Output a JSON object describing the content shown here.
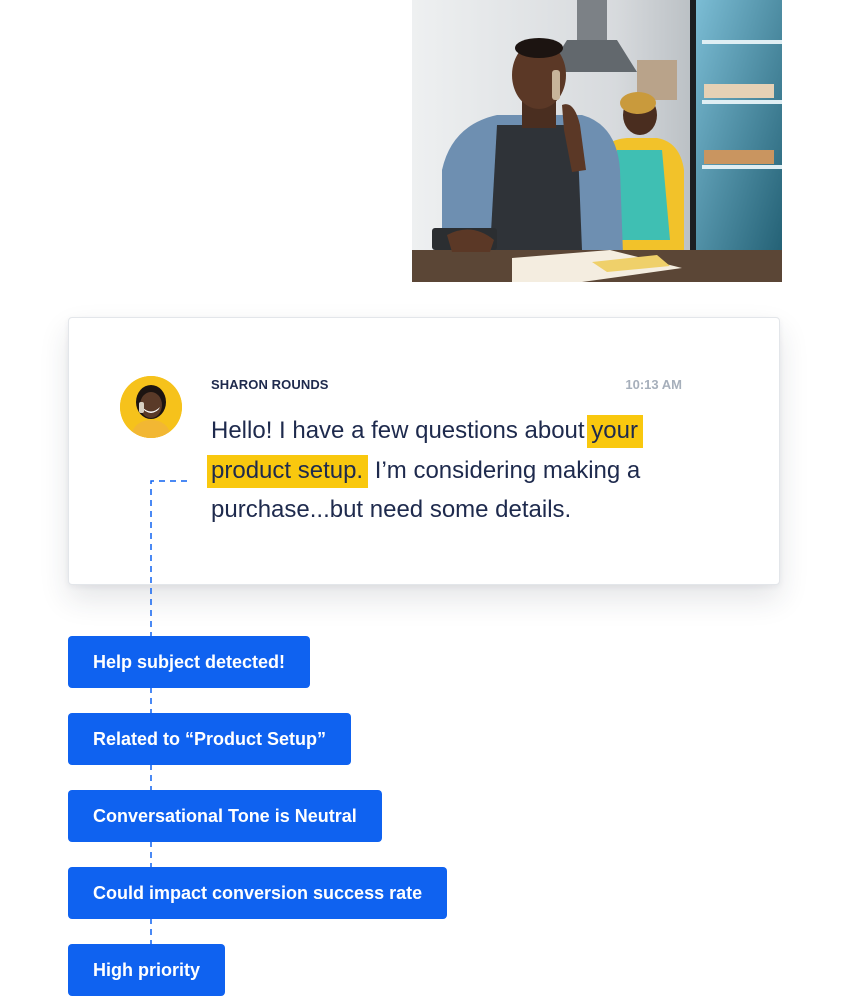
{
  "message": {
    "sender": "SHARON ROUNDS",
    "time": "10:13 AM",
    "text_before": "Hello! I have a few questions about ",
    "highlight": "your product setup.",
    "text_after": " I’m considering making a purchase...but need some details."
  },
  "insights": [
    "Help subject detected!",
    "Related to “Product Setup”",
    "Conversational Tone is Neutral",
    "Could impact conversion success rate",
    "High priority"
  ],
  "colors": {
    "accent_blue": "#0f62f0",
    "highlight_yellow": "#f9c80e",
    "text_navy": "#1e2a4d",
    "muted_gray": "#a6afbb"
  }
}
